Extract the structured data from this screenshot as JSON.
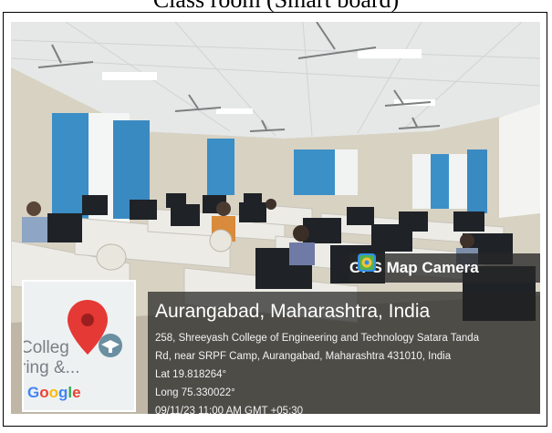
{
  "heading": "Class room (Smart board)",
  "badge": {
    "label": "GPS Map Camera"
  },
  "location": {
    "title": "Aurangabad, Maharashtra, India",
    "address_line1": "258, Shreeyash College of Engineering and Technology Satara Tanda",
    "address_line2": "Rd, near SRPF Camp, Aurangabad, Maharashtra 431010, India",
    "lat": "Lat 19.818264°",
    "long": "Long 75.330022°",
    "datetime": "09/11/23 11:00 AM GMT +05:30"
  },
  "map": {
    "label_line1": "Colleg",
    "label_line2": "ring &...",
    "brand": "Google",
    "pin_color": "#e53935",
    "cap_color": "#6a8fa0"
  },
  "colors": {
    "wall": "#d9d4c7",
    "ceiling": "#e9ebea",
    "curtain": "#3a8fc7",
    "desk": "#ecebe6",
    "monitor": "#1e2126"
  }
}
